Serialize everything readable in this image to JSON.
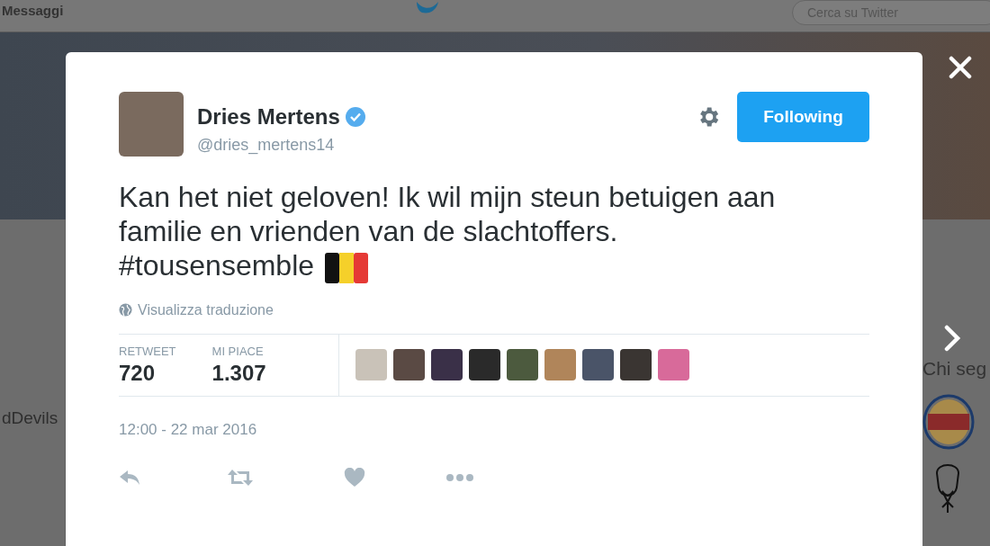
{
  "nav": {
    "messages_label": "Messaggi",
    "search": {
      "placeholder": "Cerca su Twitter"
    }
  },
  "background": {
    "left_text": "dDevils",
    "right_heading": "Chi seg"
  },
  "tweet": {
    "author": {
      "name": "Dries Mertens",
      "handle": "@dries_mertens14",
      "verified": true
    },
    "follow_button": {
      "label": "Following",
      "following": true
    },
    "text": "Kan het niet geloven! Ik wil mijn steun betuigen aan familie en vrienden van de slachtoffers. #tousensemble",
    "translate_link": "Visualizza traduzione",
    "stats": [
      {
        "label": "RETWEET",
        "value": "720"
      },
      {
        "label": "MI PIACE",
        "value": "1.307"
      }
    ],
    "likers": [
      {
        "color": "#c9c2b8"
      },
      {
        "color": "#5a4a44"
      },
      {
        "color": "#3a3048"
      },
      {
        "color": "#2a2a2a"
      },
      {
        "color": "#4c5a3e"
      },
      {
        "color": "#b0855a"
      },
      {
        "color": "#4a5468"
      },
      {
        "color": "#3a3532"
      },
      {
        "color": "#d86a9a"
      }
    ],
    "timestamp": "12:00 - 22 mar 2016"
  }
}
